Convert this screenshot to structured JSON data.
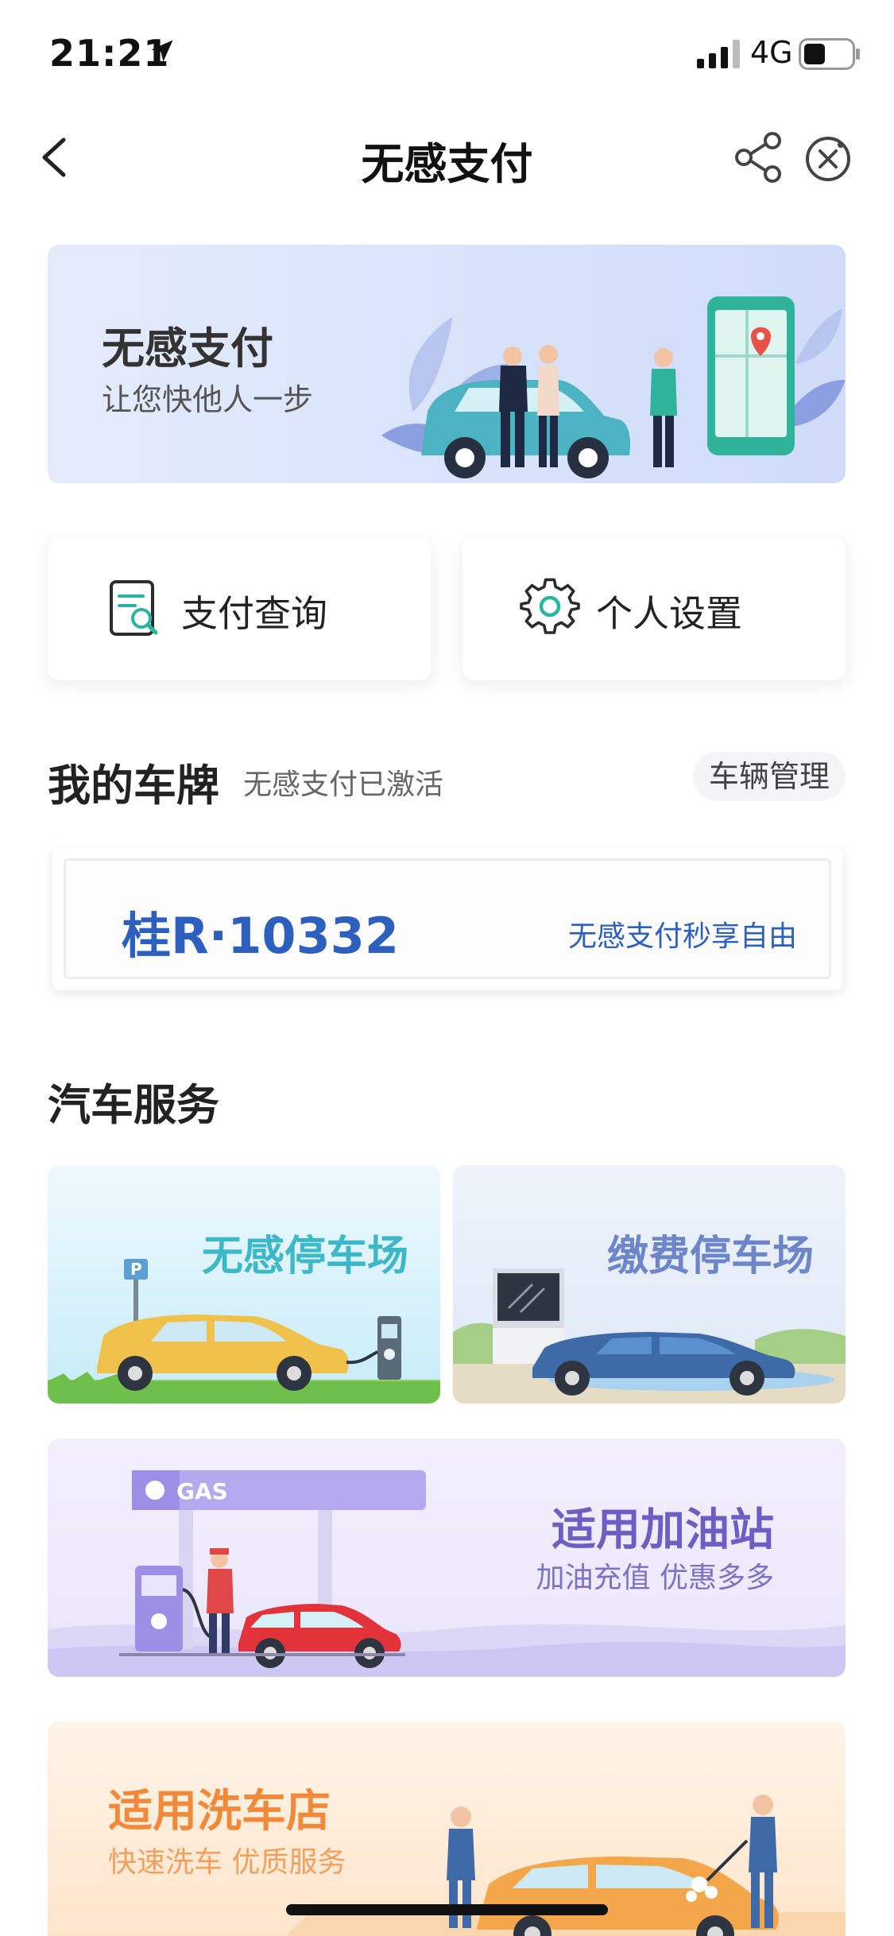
{
  "status_bar": {
    "time": "21:21",
    "network": "4G"
  },
  "nav": {
    "title": "无感支付"
  },
  "banner": {
    "title": "无感支付",
    "subtitle": "让您快他人一步"
  },
  "quick_actions": [
    {
      "label": "支付查询",
      "icon": "search-document-icon"
    },
    {
      "label": "个人设置",
      "icon": "gear-icon"
    }
  ],
  "plate_section": {
    "title": "我的车牌",
    "status": "无感支付已激活",
    "manage_label": "车辆管理",
    "plate_number": "桂R·10332",
    "slogan": "无感支付秒享自由"
  },
  "services": {
    "title": "汽车服务",
    "cards": [
      {
        "label": "无感停车场"
      },
      {
        "label": "缴费停车场"
      }
    ],
    "gas": {
      "title": "适用加油站",
      "subtitle": "加油充值 优惠多多",
      "sign": "GAS"
    },
    "wash": {
      "title": "适用洗车店",
      "subtitle": "快速洗车 优质服务"
    }
  },
  "colors": {
    "plate_blue": "#2d5fbf",
    "teal": "#3cb8c8",
    "icon_teal": "#2bb5a0",
    "gas_purple": "#6d5ec4",
    "wash_orange": "#f08a3a"
  }
}
